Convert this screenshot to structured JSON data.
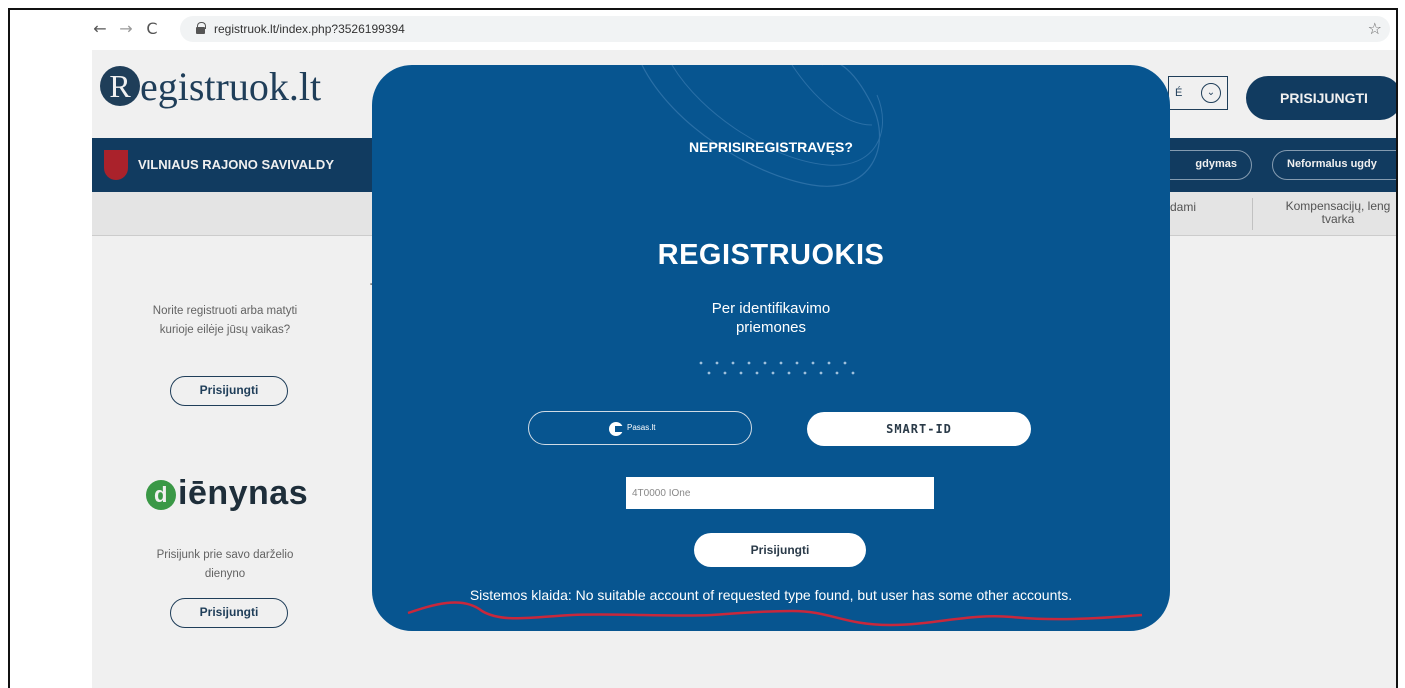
{
  "browser": {
    "url": "registruok.lt/index.php?35261993​94",
    "back": "←",
    "forward": "→",
    "reload": "C",
    "star": "☆"
  },
  "site": {
    "logo_initial": "R",
    "logo_rest": "egistruok.lt",
    "lang_label": "É",
    "login_button": "PRISIJUNGTI",
    "municipality": "VILNIAUS RAJONO SAVIVALDY",
    "pill_ugdymas": "gdymas",
    "pill_neformalus": "Neformalus ugdy",
    "subnav_item_1": "dami",
    "subnav_item_2": "Kompensacijų, leng tvarka",
    "t_letter": "T",
    "left_text_1": "Norite registruoti arba matyti kurioje eilėje jūsų vaikas?",
    "left_button_1": "Prisijungti",
    "dienynas_initial": "d",
    "dienynas_rest": "iēnynas",
    "left_text_2": "Prisijunk prie savo darželio dienyno",
    "left_button_2": "Prisijungti"
  },
  "modal": {
    "title": "NEPRISIREGISTRAVĘS?",
    "heading": "REGISTRUOKIS",
    "sub_line_1": "Per identiﬁkavimo",
    "sub_line_2": "priemones",
    "pasas_label": "Pasas.lt",
    "smartid_label": "SMART-ID",
    "input_value": "4T0000 IOne",
    "login_button": "Prisijungti",
    "error": "Sistemos klaida: No suitable account of requested type found, but user has some other accounts."
  },
  "colors": {
    "modal_bg": "#075590",
    "brand_dark": "#0e3b63",
    "error_underline": "#c8283c"
  }
}
